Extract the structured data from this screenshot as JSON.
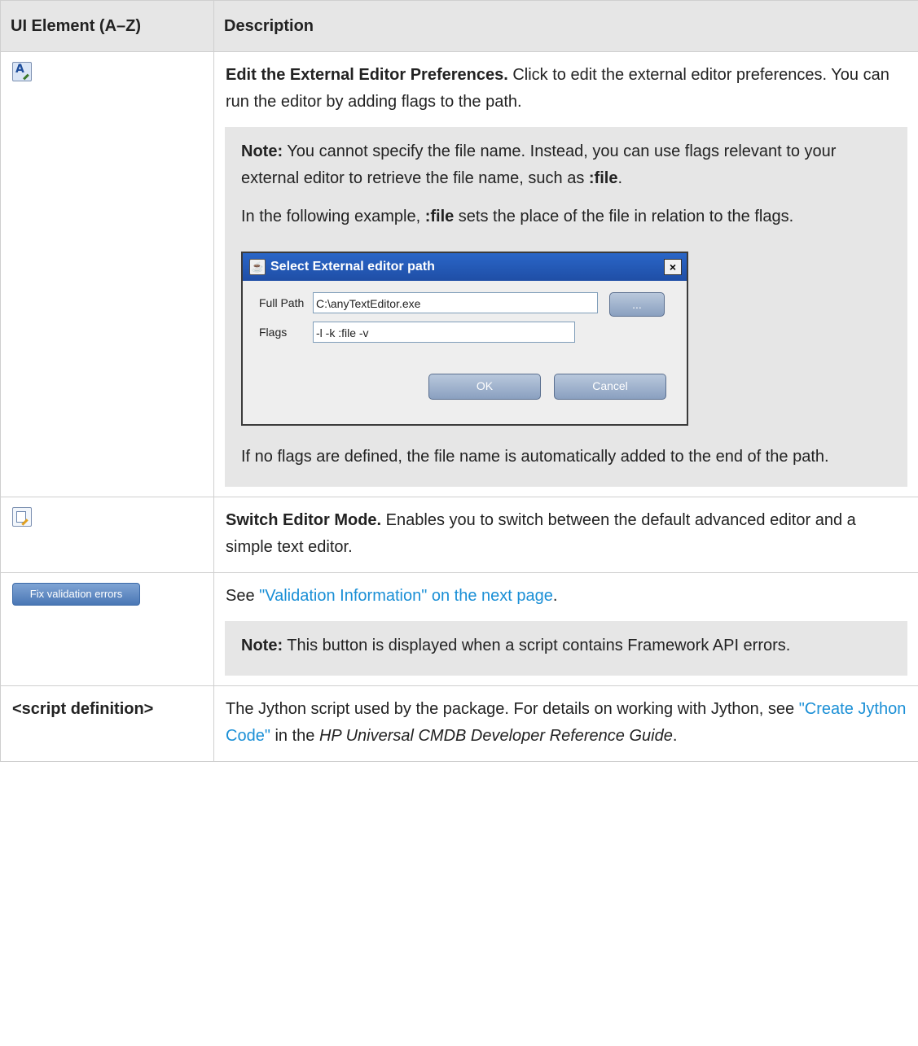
{
  "header": {
    "col1": "UI Element (A–Z)",
    "col2": "Description"
  },
  "rows": {
    "r1": {
      "icon": "edit-external-editor-icon",
      "title": "Edit the External Editor Preferences.",
      "text": " Click to edit the external editor preferences. You can run the editor by adding flags to the path.",
      "note": {
        "label": "Note:",
        "p1a": " You cannot specify the file name. Instead, you can use flags relevant to your external editor to retrieve the file name, such as ",
        "p1b": ":file",
        "p1c": ".",
        "p2a": "In the following example, ",
        "p2b": ":file",
        "p2c": " sets the place of the file in relation to the flags.",
        "p3": "If no flags are defined, the file name is automatically added to the end of the path."
      },
      "dialog": {
        "title": "Select External editor path",
        "close": "×",
        "full_path_label": "Full Path",
        "full_path_value": "C:\\anyTextEditor.exe",
        "browse": "...",
        "flags_label": "Flags",
        "flags_value": "-l -k :file -v",
        "ok": "OK",
        "cancel": "Cancel"
      }
    },
    "r2": {
      "icon": "switch-editor-mode-icon",
      "title": "Switch Editor Mode.",
      "text": " Enables you to switch between the default advanced editor and a simple text editor."
    },
    "r3": {
      "button": "Fix validation errors",
      "see": "See ",
      "link": "\"Validation Information\" on the next page",
      "period": ".",
      "note_label": "Note:",
      "note_text": " This button is displayed when a script contains Framework API errors."
    },
    "r4": {
      "element": "<script definition>",
      "t1": "The Jython script used by the package. For details on working with Jython, see ",
      "link": "\"Create Jython Code\"",
      "t2": " in the ",
      "guide": "HP Universal CMDB Developer Reference Guide",
      "t3": "."
    }
  },
  "colors": {
    "link": "#1a8fd6",
    "header_bg": "#e6e6e6",
    "note_bg": "#e6e6e6"
  }
}
